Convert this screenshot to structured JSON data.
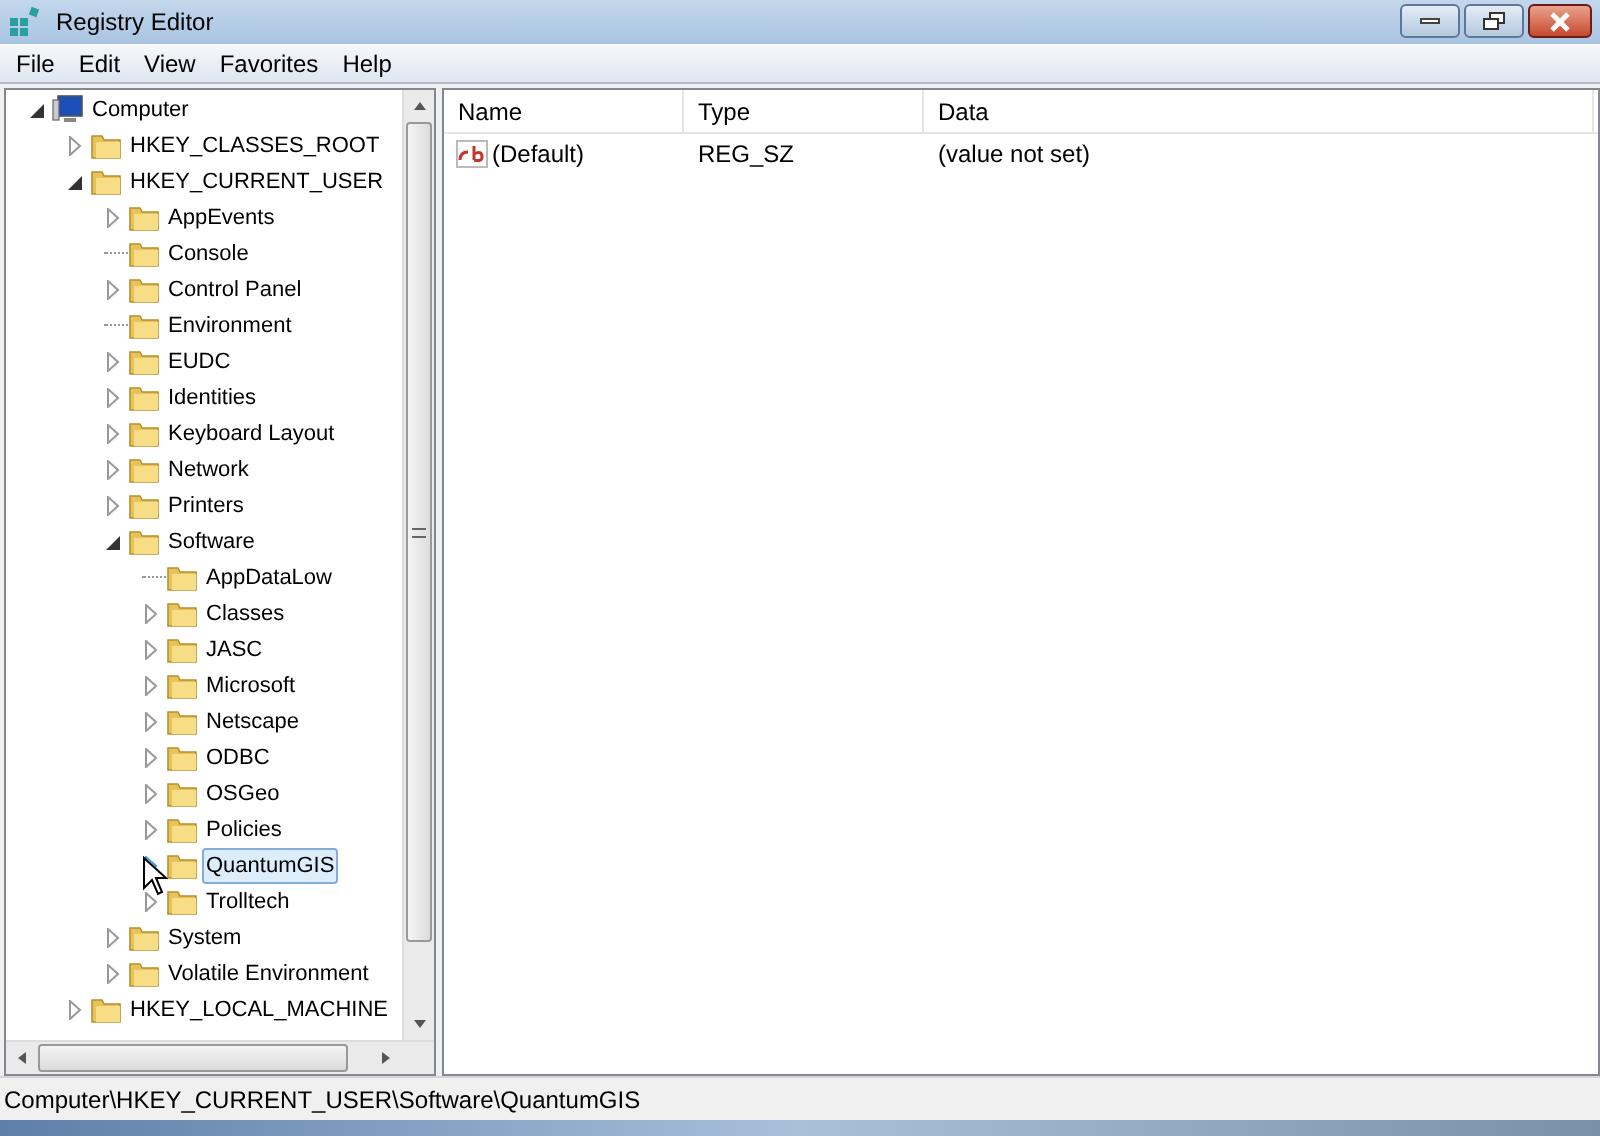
{
  "window": {
    "title": "Registry Editor"
  },
  "menu": [
    "File",
    "Edit",
    "View",
    "Favorites",
    "Help"
  ],
  "tree": [
    {
      "label": "Computer",
      "kind": "computer",
      "expanded": true,
      "selected": false,
      "children": [
        {
          "label": "HKEY_CLASSES_ROOT",
          "kind": "branch",
          "expanded": false,
          "selected": false
        },
        {
          "label": "HKEY_CURRENT_USER",
          "kind": "branch",
          "expanded": true,
          "selected": false,
          "children": [
            {
              "label": "AppEvents",
              "kind": "branch",
              "expanded": false,
              "selected": false
            },
            {
              "label": "Console",
              "kind": "leaf",
              "selected": false
            },
            {
              "label": "Control Panel",
              "kind": "branch",
              "expanded": false,
              "selected": false
            },
            {
              "label": "Environment",
              "kind": "leaf",
              "selected": false
            },
            {
              "label": "EUDC",
              "kind": "branch",
              "expanded": false,
              "selected": false
            },
            {
              "label": "Identities",
              "kind": "branch",
              "expanded": false,
              "selected": false
            },
            {
              "label": "Keyboard Layout",
              "kind": "branch",
              "expanded": false,
              "selected": false
            },
            {
              "label": "Network",
              "kind": "branch",
              "expanded": false,
              "selected": false
            },
            {
              "label": "Printers",
              "kind": "branch",
              "expanded": false,
              "selected": false
            },
            {
              "label": "Software",
              "kind": "branch",
              "expanded": true,
              "selected": false,
              "children": [
                {
                  "label": "AppDataLow",
                  "kind": "leaf",
                  "selected": false
                },
                {
                  "label": "Classes",
                  "kind": "branch",
                  "expanded": false,
                  "selected": false
                },
                {
                  "label": "JASC",
                  "kind": "branch",
                  "expanded": false,
                  "selected": false
                },
                {
                  "label": "Microsoft",
                  "kind": "branch",
                  "expanded": false,
                  "selected": false
                },
                {
                  "label": "Netscape",
                  "kind": "branch",
                  "expanded": false,
                  "selected": false
                },
                {
                  "label": "ODBC",
                  "kind": "branch",
                  "expanded": false,
                  "selected": false
                },
                {
                  "label": "OSGeo",
                  "kind": "branch",
                  "expanded": false,
                  "selected": false
                },
                {
                  "label": "Policies",
                  "kind": "branch",
                  "expanded": false,
                  "selected": false
                },
                {
                  "label": "QuantumGIS",
                  "kind": "branch",
                  "expanded": false,
                  "selected": true
                },
                {
                  "label": "Trolltech",
                  "kind": "branch",
                  "expanded": false,
                  "selected": false
                }
              ]
            },
            {
              "label": "System",
              "kind": "branch",
              "expanded": false,
              "selected": false
            },
            {
              "label": "Volatile Environment",
              "kind": "branch",
              "expanded": false,
              "selected": false
            }
          ]
        },
        {
          "label": "HKEY_LOCAL_MACHINE",
          "kind": "branch",
          "expanded": false,
          "selected": false
        }
      ]
    }
  ],
  "values": {
    "columns": [
      "Name",
      "Type",
      "Data"
    ],
    "rows": [
      {
        "name": "(Default)",
        "type": "REG_SZ",
        "data": "(value not set)"
      }
    ]
  },
  "status_bar": "Computer\\HKEY_CURRENT_USER\\Software\\QuantumGIS"
}
